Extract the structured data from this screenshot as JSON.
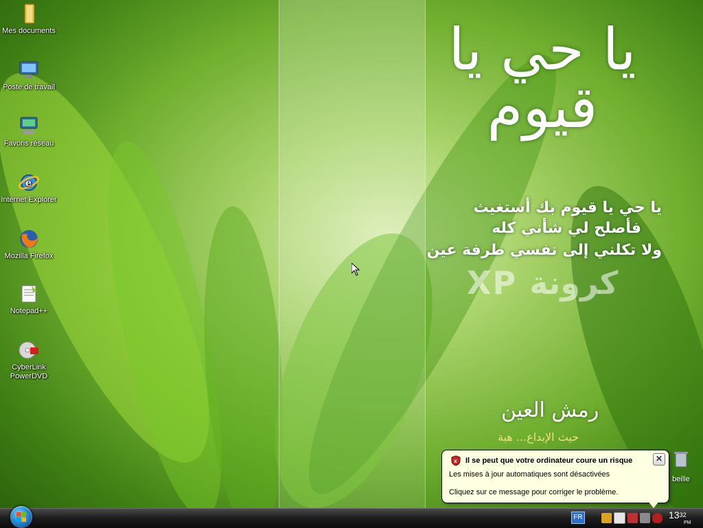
{
  "desktop": {
    "icons": [
      {
        "label": "Mes documents",
        "icon": "folder-icon"
      },
      {
        "label": "Poste de travail",
        "icon": "computer-icon"
      },
      {
        "label": "Favoris réseau",
        "icon": "network-icon"
      },
      {
        "label": "Internet Explorer",
        "icon": "internet-explorer-icon"
      },
      {
        "label": "Mozilla Firefox",
        "icon": "firefox-icon"
      },
      {
        "label": "Notepad++",
        "icon": "notepad-icon"
      },
      {
        "label": "CyberLink PowerDVD",
        "icon": "powerdvd-icon"
      }
    ],
    "recycle_label": "beille"
  },
  "wallpaper": {
    "calligraphy": "يا حي يا قيوم",
    "verse_lines": [
      "يا حي يا قيوم بك أستغيث",
      "فأصلح لي شأني كله",
      "ولا تكلني إلى نفسي طرفة عين"
    ],
    "brand": "XP كرونة",
    "signature": "رمش العين",
    "tagline": "حيث الإبداع... هبة"
  },
  "balloon": {
    "title": "Il se peut que votre ordinateur coure un risque",
    "line1": "Les mises à jour automatiques sont désactivées",
    "line2": "Cliquez sur ce message pour corriger le problème.",
    "close": "✕"
  },
  "taskbar": {
    "language": "FR",
    "clock_hour": "13",
    "clock_min": "32",
    "clock_ampm": "PM"
  },
  "colors": {
    "accent": "#2b8fd6",
    "balloon_bg": "#ffffe1"
  }
}
